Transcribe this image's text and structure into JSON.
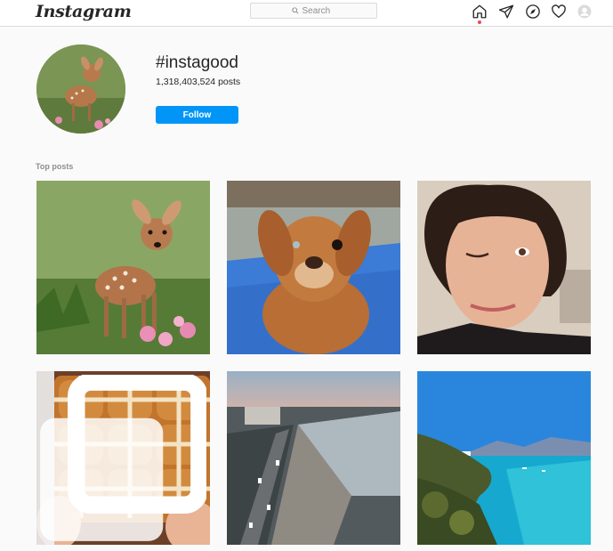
{
  "header": {
    "logo_text": "Instagram",
    "search_placeholder": "Search",
    "nav_icons": [
      "home-icon",
      "direct-icon",
      "explore-icon",
      "activity-heart-icon",
      "profile-avatar-icon"
    ]
  },
  "hashtag": {
    "title": "#instagood",
    "posts_count": "1,318,403,524 posts",
    "follow_label": "Follow"
  },
  "section": {
    "top_posts_label": "Top posts"
  },
  "colors": {
    "accent": "#0095f6",
    "notification": "#ed4956",
    "border": "#dbdbdb"
  },
  "posts": [
    {
      "subject": "fawn"
    },
    {
      "subject": "dog"
    },
    {
      "subject": "woman-winking"
    },
    {
      "subject": "hot-cross-buns",
      "multi": true
    },
    {
      "subject": "city-waterfront"
    },
    {
      "subject": "turquoise-bay"
    }
  ]
}
